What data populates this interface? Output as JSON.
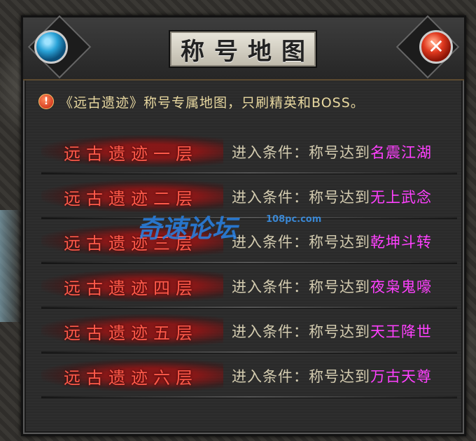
{
  "window": {
    "title": "称号地图"
  },
  "notice": "《远古遗迹》称号专属地图，只刷精英和BOSS。",
  "condition_label": "进入条件：称号达到",
  "floors": [
    {
      "name": "远古遗迹一层",
      "required_title": "名震江湖"
    },
    {
      "name": "远古遗迹二层",
      "required_title": "无上武念"
    },
    {
      "name": "远古遗迹三层",
      "required_title": "乾坤斗转"
    },
    {
      "name": "远古遗迹四层",
      "required_title": "夜枭鬼嚎"
    },
    {
      "name": "远古遗迹五层",
      "required_title": "天王降世"
    },
    {
      "name": "远古遗迹六层",
      "required_title": "万古天尊"
    }
  ],
  "watermark": {
    "text": "奇速论坛",
    "site": "108pc.com"
  },
  "icons": {
    "left_orb": "blue-orb-icon",
    "close": "close-icon",
    "warning": "warning-icon"
  }
}
